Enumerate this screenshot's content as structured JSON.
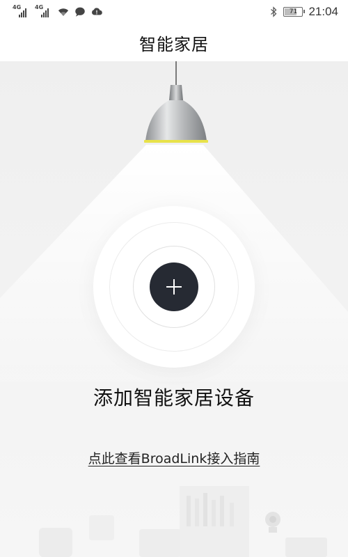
{
  "status_bar": {
    "signal_1": {
      "network": "4G"
    },
    "signal_2": {
      "network": "4G"
    },
    "battery": {
      "level": 71,
      "text": "71"
    },
    "time": "21:04",
    "icons": [
      "signal-icon",
      "signal-icon",
      "wifi-icon",
      "chat-icon",
      "cloud-icon",
      "bluetooth-icon",
      "battery-icon"
    ]
  },
  "header": {
    "title": "智能家居"
  },
  "main": {
    "lamp_icon": "pendant-lamp",
    "add_button_icon": "plus-icon",
    "add_title": "添加智能家居设备",
    "guide_link": "点此查看BroadLink接入指南"
  },
  "colors": {
    "button": "#262a33",
    "lamp_rim": "#e8e24a",
    "background": "#f3f3f3"
  }
}
